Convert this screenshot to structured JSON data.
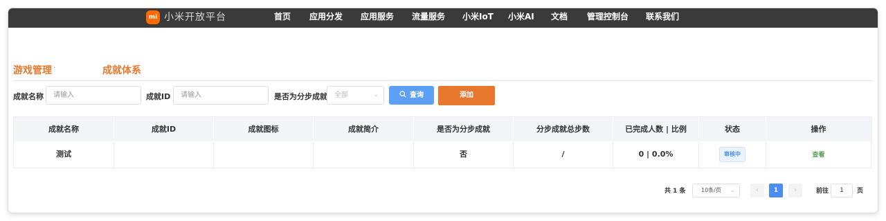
{
  "nav": {
    "logo_text": "mi",
    "brand": "小米开放平台",
    "items": [
      "首页",
      "应用分发",
      "应用服务",
      "流量服务",
      "小米IoT",
      "小米AI",
      "文档",
      "管理控制台",
      "联系我们"
    ]
  },
  "breadcrumb": {
    "main": "游戏管理",
    "separator": "·",
    "sub": "成就体系"
  },
  "filters": {
    "name_label": "成就名称",
    "name_placeholder": "请输入",
    "id_label": "成就ID",
    "id_placeholder": "请输入",
    "step_label": "是否为分步成就",
    "step_value": "全部",
    "query_label": "查询",
    "add_label": "添加"
  },
  "table": {
    "headers": [
      "成就名称",
      "成就ID",
      "成就图标",
      "成就简介",
      "是否为分步成就",
      "分步成就总步数",
      "已完成人数 | 比例",
      "状态",
      "操作"
    ],
    "rows": [
      {
        "name": "测试",
        "id": "",
        "icon": "",
        "intro": "",
        "is_step": "否",
        "total_steps": "/",
        "completed": "0  |  0.0%",
        "status": "审核中",
        "action": "查看"
      }
    ]
  },
  "pagination": {
    "total": "共 1 条",
    "page_size": "10条/页",
    "prev": "‹",
    "current_page": "1",
    "next": "›",
    "goto_label": "前往",
    "goto_value": "1",
    "page_suffix": "页"
  },
  "colors": {
    "accent": "#e8772e",
    "primary": "#4a8df5",
    "nav_bg": "#3a3a3a",
    "logo": "#ff6900"
  }
}
